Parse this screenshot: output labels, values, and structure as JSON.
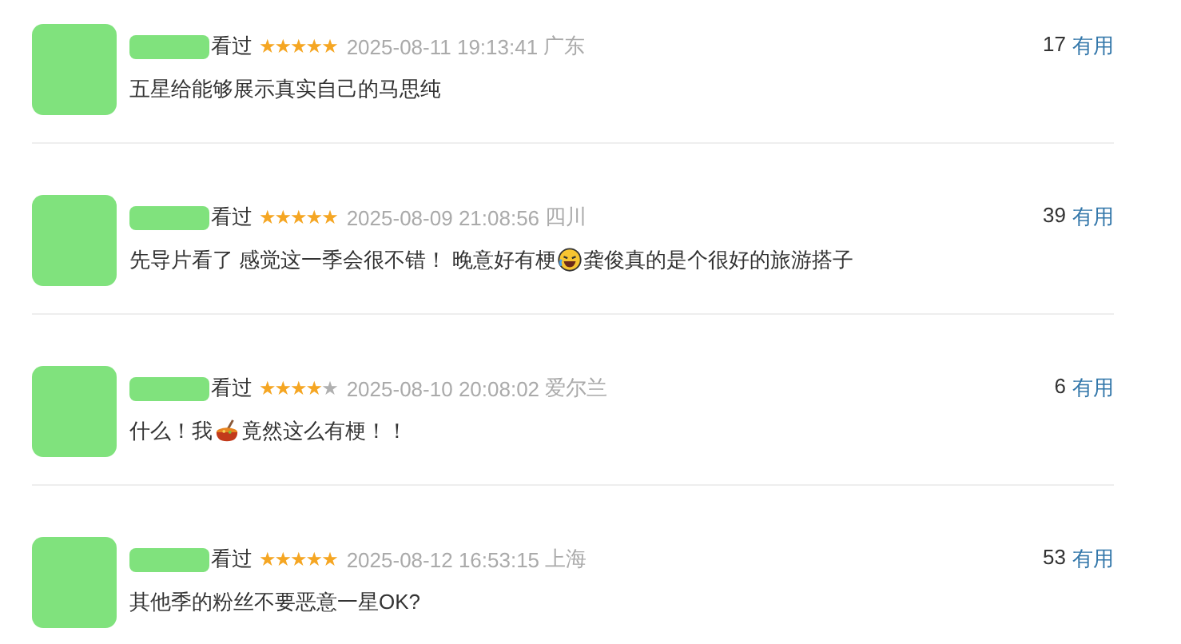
{
  "comments": [
    {
      "status": "看过",
      "stars": 5,
      "time": "2025-08-11 19:13:41",
      "location": "广东",
      "votes": "17",
      "vote_label": "有用",
      "content": [
        {
          "kind": "text",
          "text": "五星给能够展示真实自己的马思纯"
        }
      ]
    },
    {
      "status": "看过",
      "stars": 5,
      "time": "2025-08-09 21:08:56",
      "location": "四川",
      "votes": "39",
      "vote_label": "有用",
      "content": [
        {
          "kind": "text",
          "text": "先导片看了 感觉这一季会很不错！ 晚意好有梗"
        },
        {
          "kind": "laugh"
        },
        {
          "kind": "text",
          "text": "龚俊真的是个很好的旅游搭子"
        }
      ]
    },
    {
      "status": "看过",
      "stars": 4,
      "time": "2025-08-10 20:08:02",
      "location": "爱尔兰",
      "votes": "6",
      "vote_label": "有用",
      "content": [
        {
          "kind": "text",
          "text": "什么！我"
        },
        {
          "kind": "pan"
        },
        {
          "kind": "text",
          "text": "竟然这么有梗！！"
        }
      ]
    },
    {
      "status": "看过",
      "stars": 5,
      "time": "2025-08-12 16:53:15",
      "location": "上海",
      "votes": "53",
      "vote_label": "有用",
      "content": [
        {
          "kind": "text",
          "text": "其他季的粉丝不要恶意一星OK?"
        }
      ]
    }
  ]
}
